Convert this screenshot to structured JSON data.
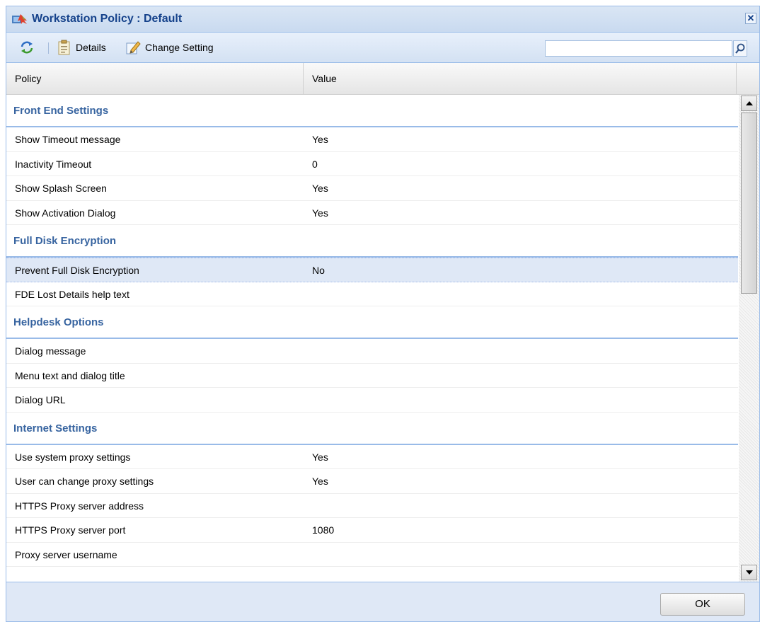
{
  "window": {
    "title": "Workstation Policy : Default",
    "close_label": "✕"
  },
  "toolbar": {
    "details_label": "Details",
    "change_setting_label": "Change Setting",
    "search_value": ""
  },
  "grid": {
    "columns": [
      "Policy",
      "Value"
    ],
    "groups": [
      {
        "name": "Front End Settings",
        "rows": [
          {
            "policy": "Show Timeout message",
            "value": "Yes"
          },
          {
            "policy": "Inactivity Timeout",
            "value": "0"
          },
          {
            "policy": "Show Splash Screen",
            "value": "Yes"
          },
          {
            "policy": "Show Activation Dialog",
            "value": "Yes"
          }
        ]
      },
      {
        "name": "Full Disk Encryption",
        "rows": [
          {
            "policy": "Prevent Full Disk Encryption",
            "value": "No",
            "selected": true
          },
          {
            "policy": "FDE Lost Details help text",
            "value": ""
          }
        ]
      },
      {
        "name": "Helpdesk Options",
        "rows": [
          {
            "policy": "Dialog message",
            "value": ""
          },
          {
            "policy": "Menu text and dialog title",
            "value": ""
          },
          {
            "policy": "Dialog URL",
            "value": ""
          }
        ]
      },
      {
        "name": "Internet Settings",
        "rows": [
          {
            "policy": "Use system proxy settings",
            "value": "Yes"
          },
          {
            "policy": "User can change proxy settings",
            "value": "Yes"
          },
          {
            "policy": "HTTPS Proxy server address",
            "value": ""
          },
          {
            "policy": "HTTPS Proxy server port",
            "value": "1080"
          },
          {
            "policy": "Proxy server username",
            "value": ""
          }
        ]
      }
    ]
  },
  "footer": {
    "ok_label": "OK"
  },
  "icons": {
    "title": "policy-icon",
    "refresh": "refresh-icon",
    "details": "details-icon",
    "change": "edit-icon",
    "search": "magnifier-icon"
  }
}
